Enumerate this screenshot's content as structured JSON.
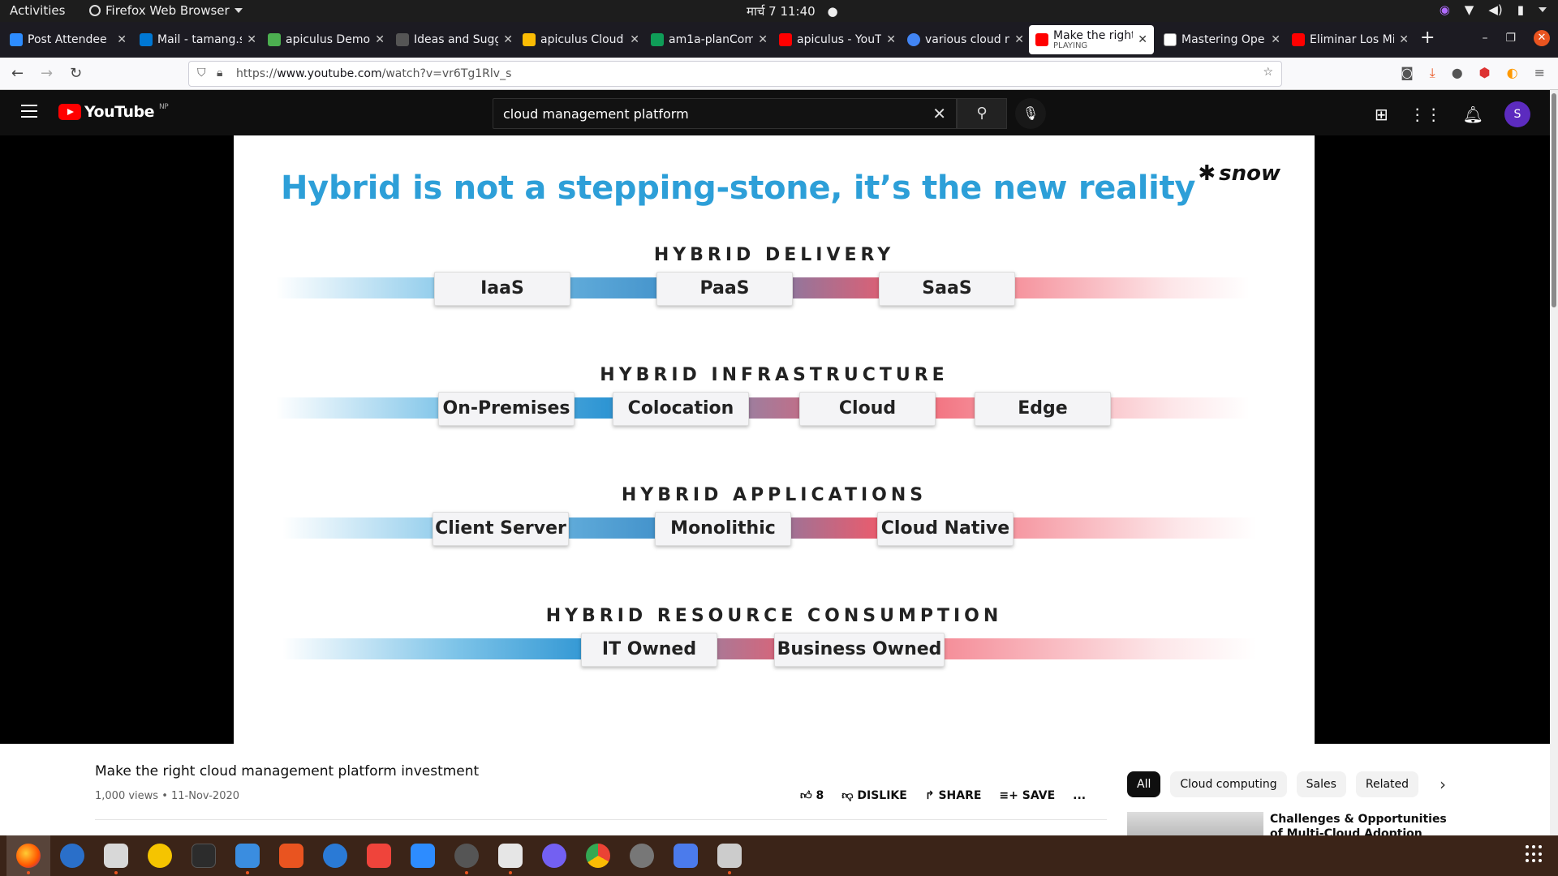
{
  "topbar": {
    "activities": "Activities",
    "app_name": "Firefox Web Browser",
    "clock": "मार्च 7  11:40"
  },
  "tabs": [
    {
      "title": "Post Attendee",
      "color": "#2d8cff"
    },
    {
      "title": "Mail - tamang.s",
      "color": "#0078d4"
    },
    {
      "title": "apiculus Demo",
      "color": "#4caf50"
    },
    {
      "title": "Ideas and Sugg",
      "color": "#888888"
    },
    {
      "title": "apiculus Cloud",
      "color": "#fbbc04"
    },
    {
      "title": "am1a-planCom",
      "color": "#0f9d58"
    },
    {
      "title": "apiculus - YouT",
      "color": "#ff0000"
    },
    {
      "title": "various cloud m",
      "color": "#4285f4"
    },
    {
      "title": "Make the right",
      "sub": "PLAYING",
      "color": "#ff0000",
      "active": true
    },
    {
      "title": "Mastering Ope",
      "color": "#ffffff"
    },
    {
      "title": "Eliminar Los Mi",
      "color": "#ff0000"
    }
  ],
  "navbar": {
    "url_prefix": "https://",
    "url_host": "www.youtube.com",
    "url_path": "/watch?v=vr6Tg1Rlv_s"
  },
  "youtube": {
    "logo": "YouTube",
    "region": "NP",
    "search_value": "cloud management platform",
    "avatar_letter": "S"
  },
  "slide": {
    "title": "Hybrid is not a stepping-stone, it’s the new reality",
    "brand": "snow",
    "rows": [
      {
        "heading": "HYBRID DELIVERY",
        "items": [
          "IaaS",
          "PaaS",
          "SaaS"
        ]
      },
      {
        "heading": "HYBRID INFRASTRUCTURE",
        "items": [
          "On-Premises",
          "Colocation",
          "Cloud",
          "Edge"
        ]
      },
      {
        "heading": "HYBRID APPLICATIONS",
        "items": [
          "Client Server",
          "Monolithic",
          "Cloud Native"
        ]
      },
      {
        "heading": "HYBRID RESOURCE CONSUMPTION",
        "items": [
          "IT Owned",
          "Business Owned"
        ]
      }
    ]
  },
  "video": {
    "title": "Make the right cloud management platform investment",
    "meta": "1,000 views • 11-Nov-2020",
    "likes": "8",
    "dislike": "DISLIKE",
    "share": "SHARE",
    "save": "SAVE",
    "more": "..."
  },
  "chips": [
    "All",
    "Cloud computing",
    "Sales",
    "Related"
  ],
  "recommendation": {
    "title": "Challenges & Opportunities of Multi-Cloud Adoption"
  },
  "colors": {
    "slide_title": "#2d9fd8",
    "band_blue": "#3a9fd6",
    "band_red": "#f05a6a",
    "youtube_red": "#ff0000",
    "dock_bg": "#3b2418"
  },
  "dock_icons": [
    "firefox-icon",
    "thunderbird-icon",
    "files-icon",
    "rhythmbox-icon",
    "terminal-icon",
    "writer-icon",
    "software-icon",
    "help-icon",
    "anydesk-icon",
    "zoom-icon",
    "clock-icon",
    "screenshot-icon",
    "viber-icon",
    "chrome-icon",
    "settings-icon",
    "display-icon",
    "image-viewer-icon"
  ]
}
